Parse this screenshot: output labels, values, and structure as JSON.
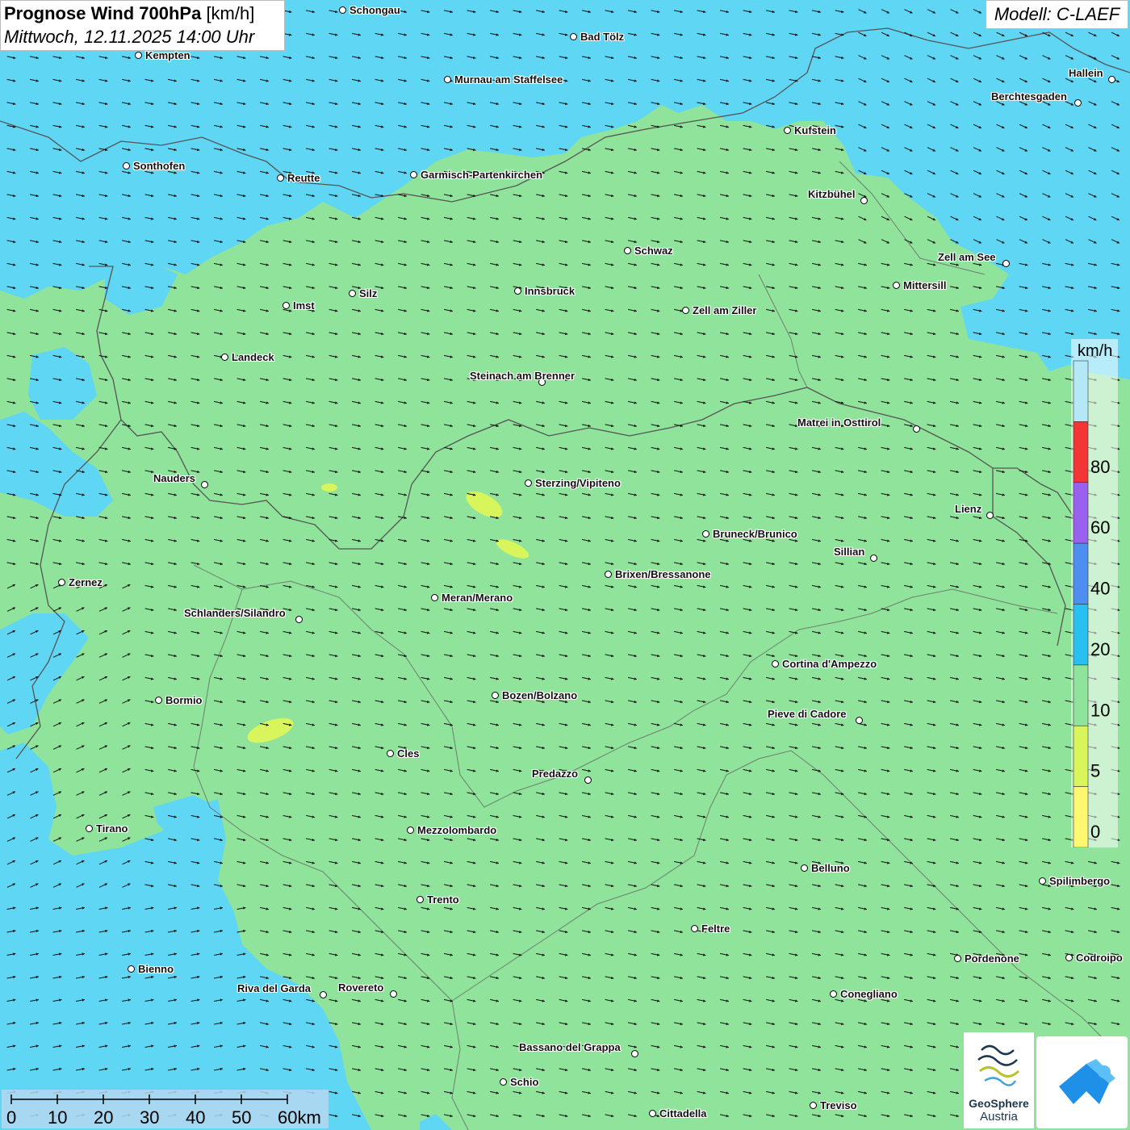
{
  "header": {
    "title_bold": "Prognose Wind 700hPa",
    "title_unit": "[km/h]",
    "subtitle": "Mittwoch, 12.11.2025 14:00 Uhr",
    "model": "Modell: C-LAEF"
  },
  "legend": {
    "unit": "km/h",
    "bins": [
      {
        "from": 0,
        "to": 5,
        "color": "#fff870"
      },
      {
        "from": 5,
        "to": 10,
        "color": "#d8f55c"
      },
      {
        "from": 10,
        "to": 20,
        "color": "#8fe39a"
      },
      {
        "from": 20,
        "to": 40,
        "color": "#28c0f0"
      },
      {
        "from": 40,
        "to": 60,
        "color": "#4d8ef0"
      },
      {
        "from": 60,
        "to": 80,
        "color": "#9a60ee"
      },
      {
        "from": 80,
        "to": 100,
        "color": "#f43535"
      },
      {
        "from": 100,
        "to": 120,
        "color": "#b5e8f7"
      }
    ],
    "tick_labels": [
      "0",
      "5",
      "10",
      "20",
      "40",
      "60",
      "80"
    ]
  },
  "scale_bar": {
    "labels": [
      "0",
      "10",
      "20",
      "30",
      "40",
      "50",
      "60km"
    ]
  },
  "logos": {
    "geosphere_line1": "GeoSphere",
    "geosphere_line2": "Austria",
    "app_icon": "weather-app-icon"
  },
  "wind_field": {
    "dominant_direction": "west-northwest",
    "speed_range_kmh": [
      10,
      20
    ],
    "arrow_symbol": "arrow-icon"
  },
  "cities": [
    {
      "name": "Schongau"
    },
    {
      "name": "Bad Tölz"
    },
    {
      "name": "Kempten"
    },
    {
      "name": "Murnau am Staffelsee"
    },
    {
      "name": "Hallein"
    },
    {
      "name": "Berchtesgaden"
    },
    {
      "name": "Kufstein"
    },
    {
      "name": "Sonthofen"
    },
    {
      "name": "Reutte"
    },
    {
      "name": "Garmisch-Partenkirchen"
    },
    {
      "name": "Kitzbühel"
    },
    {
      "name": "Schwaz"
    },
    {
      "name": "Zell am See"
    },
    {
      "name": "Mittersill"
    },
    {
      "name": "Silz"
    },
    {
      "name": "Innsbruck"
    },
    {
      "name": "Imst"
    },
    {
      "name": "Zell am Ziller"
    },
    {
      "name": "Landeck"
    },
    {
      "name": "Steinach am Brenner"
    },
    {
      "name": "Matrei in Osttirol"
    },
    {
      "name": "Nauders"
    },
    {
      "name": "Sterzing/Vipiteno"
    },
    {
      "name": "Lienz"
    },
    {
      "name": "Bruneck/Brunico"
    },
    {
      "name": "Sillian"
    },
    {
      "name": "Zernez"
    },
    {
      "name": "Brixen/Bressanone"
    },
    {
      "name": "Meran/Merano"
    },
    {
      "name": "Schlanders/Silandro"
    },
    {
      "name": "Cortina d'Ampezzo"
    },
    {
      "name": "Bozen/Bolzano"
    },
    {
      "name": "Bormio"
    },
    {
      "name": "Pieve di Cadore"
    },
    {
      "name": "Cles"
    },
    {
      "name": "Predazzo"
    },
    {
      "name": "Tirano"
    },
    {
      "name": "Mezzolombardo"
    },
    {
      "name": "Belluno"
    },
    {
      "name": "Spilimbergo"
    },
    {
      "name": "Trento"
    },
    {
      "name": "Feltre"
    },
    {
      "name": "Pordenone"
    },
    {
      "name": "Codroipo"
    },
    {
      "name": "Bienno"
    },
    {
      "name": "Riva del Garda"
    },
    {
      "name": "Rovereto"
    },
    {
      "name": "Conegliano"
    },
    {
      "name": "Bassano del Grappa"
    },
    {
      "name": "Schio"
    },
    {
      "name": "Treviso"
    },
    {
      "name": "Cittadella"
    }
  ]
}
